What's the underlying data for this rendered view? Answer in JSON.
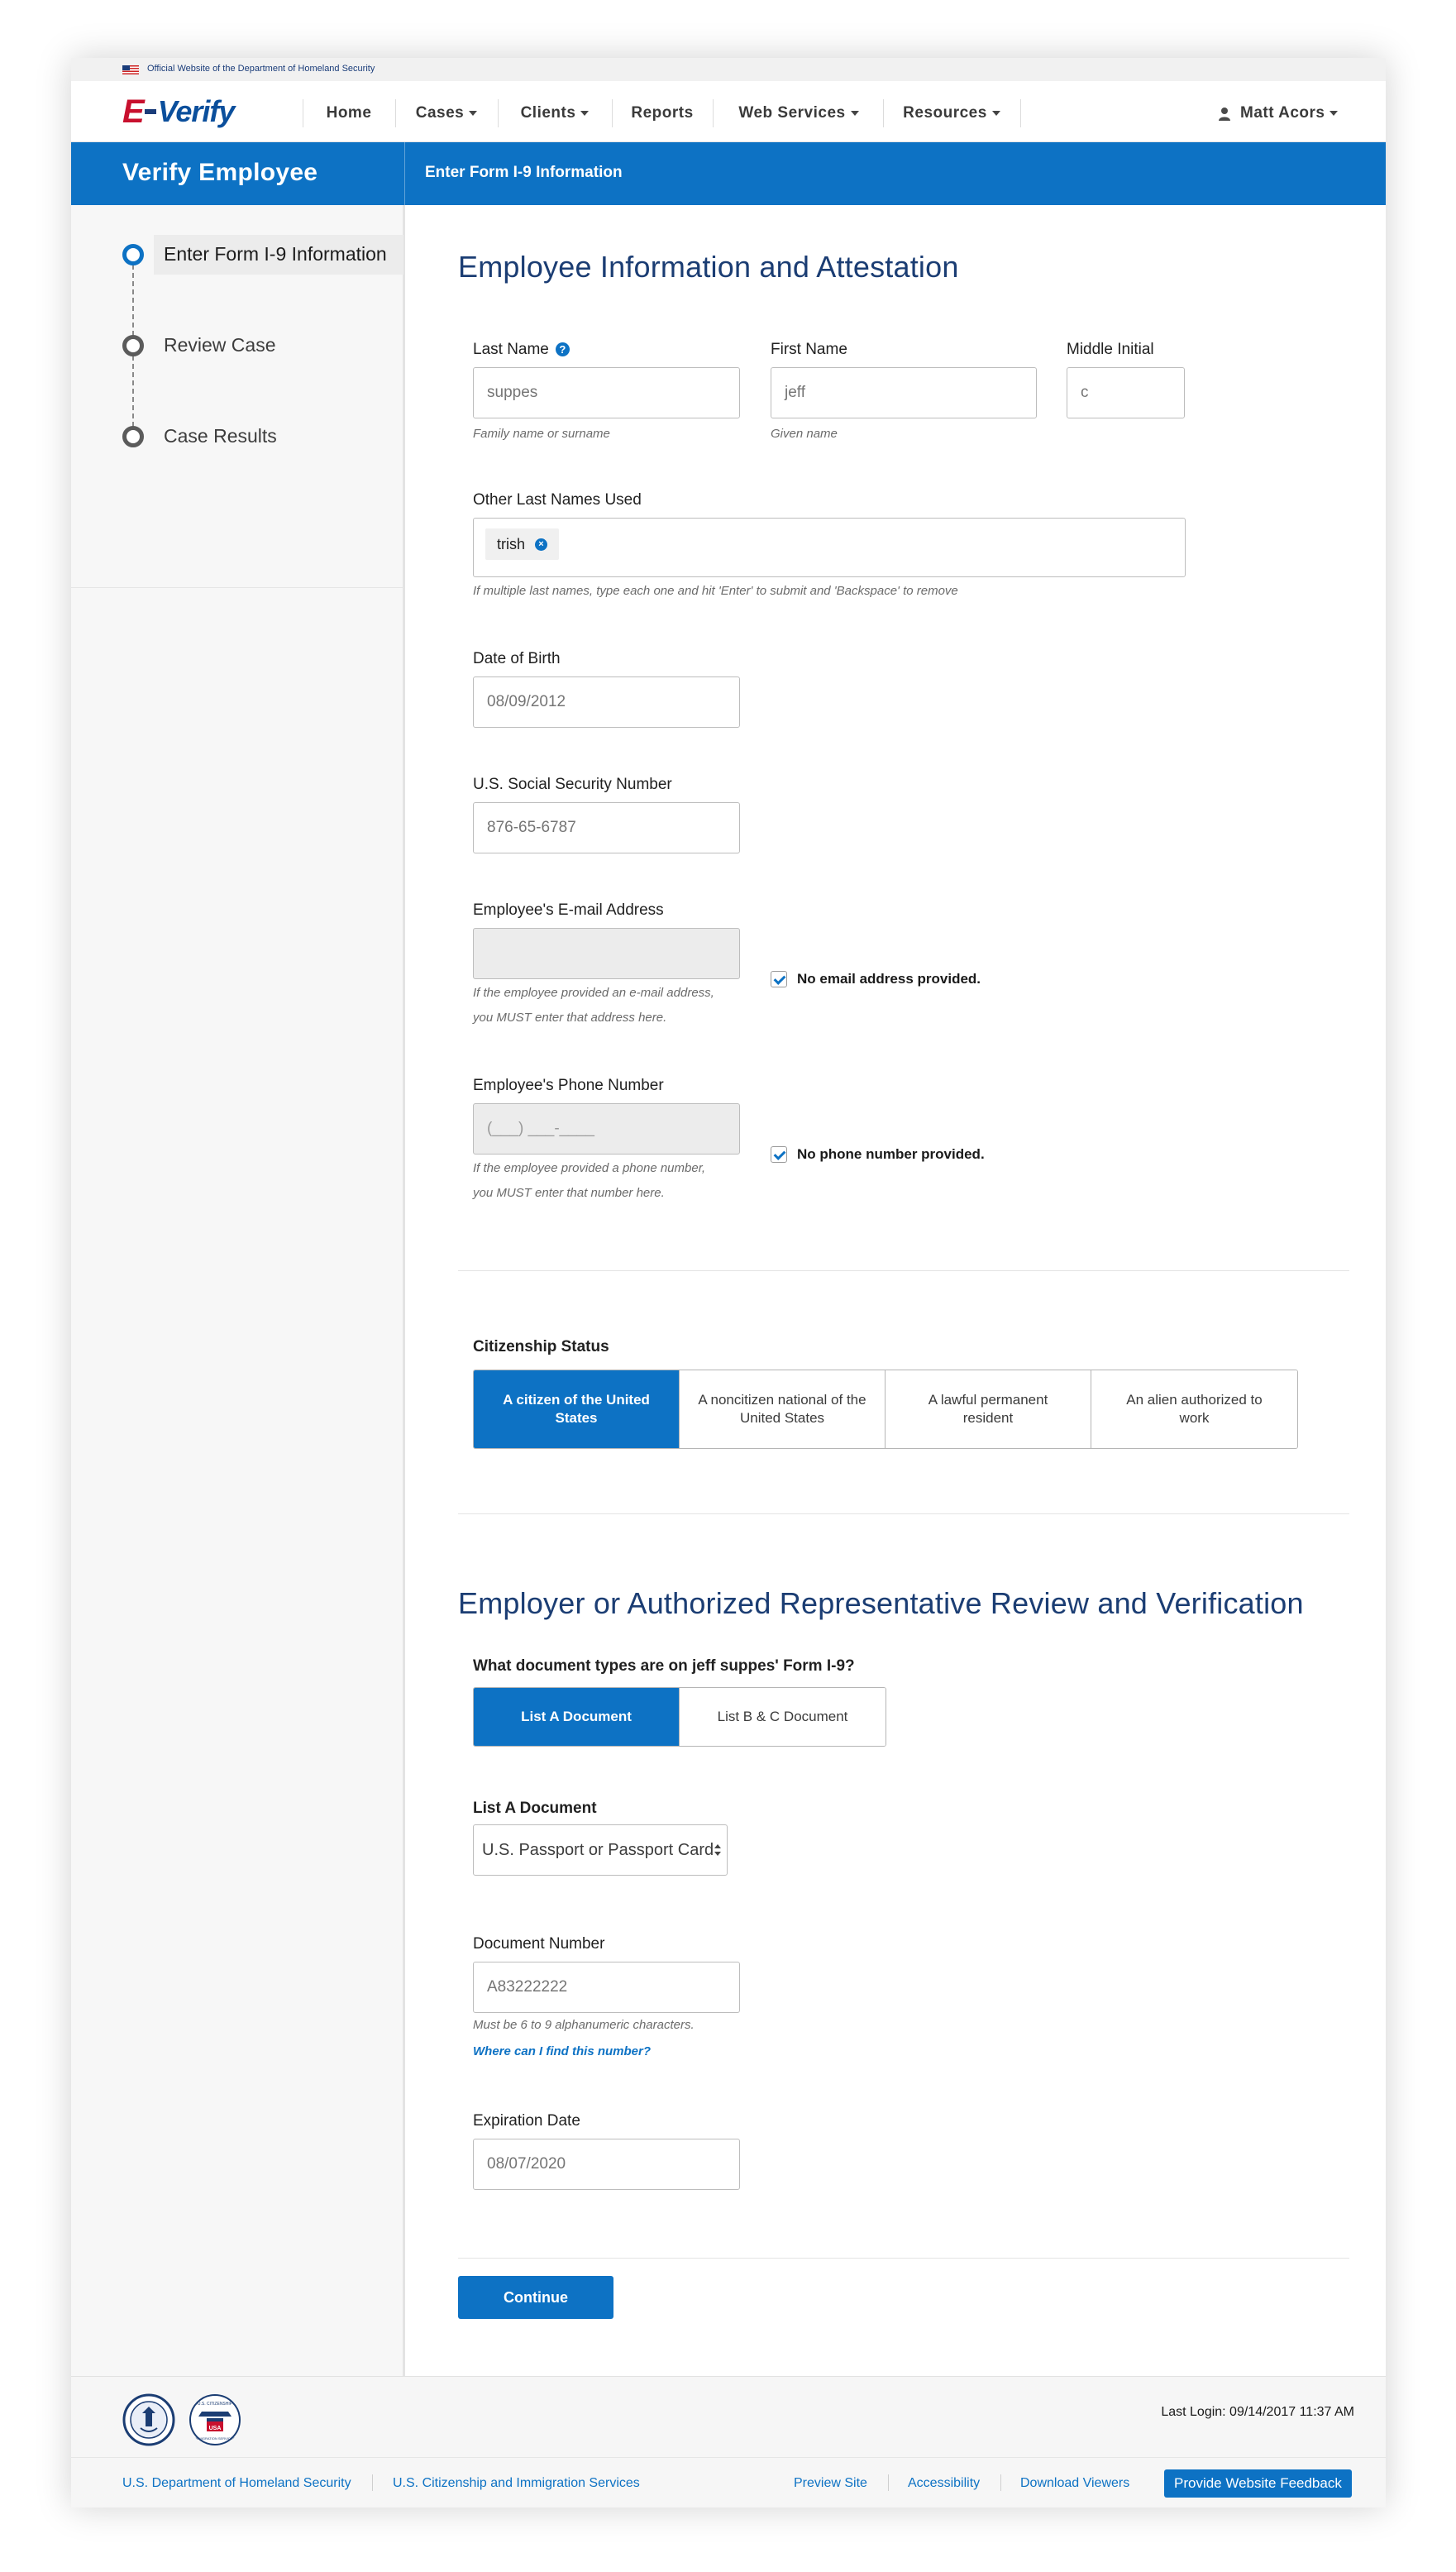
{
  "gov_banner": {
    "text": "Official Website of the Department of Homeland Security"
  },
  "header": {
    "logo_e": "E",
    "logo_verify": "Verify",
    "nav": [
      {
        "label": "Home",
        "has_caret": false
      },
      {
        "label": "Cases",
        "has_caret": true
      },
      {
        "label": "Clients",
        "has_caret": true
      },
      {
        "label": "Reports",
        "has_caret": false
      },
      {
        "label": "Web Services",
        "has_caret": true
      },
      {
        "label": "Resources",
        "has_caret": true
      }
    ],
    "user": {
      "name": "Matt Acors",
      "icon": "user-icon"
    }
  },
  "titlebar": {
    "left": "Verify Employee",
    "right": "Enter Form I-9 Information"
  },
  "steps": [
    {
      "label": "Enter Form I-9 Information",
      "active": true
    },
    {
      "label": "Review Case",
      "active": false
    },
    {
      "label": "Case Results",
      "active": false
    }
  ],
  "section1": {
    "title": "Employee Information and Attestation",
    "last_name": {
      "label": "Last Name",
      "value": "suppes",
      "hint": "Family name or surname"
    },
    "first_name": {
      "label": "First Name",
      "value": "jeff",
      "hint": "Given name"
    },
    "middle_initial": {
      "label": "Middle Initial",
      "value": "c"
    },
    "other_last_names": {
      "label": "Other Last Names Used",
      "chips": [
        "trish"
      ],
      "hint": "If multiple last names, type each one and hit 'Enter' to submit and 'Backspace' to remove"
    },
    "dob": {
      "label": "Date of Birth",
      "value": "08/09/2012"
    },
    "ssn": {
      "label": "U.S. Social Security Number",
      "value": "876-65-6787"
    },
    "email": {
      "label": "Employee's E-mail Address",
      "value": "",
      "hint1": "If the employee provided an e-mail address,",
      "hint2": "you MUST enter that address here.",
      "checkbox_label": "No email address provided.",
      "checked": true
    },
    "phone": {
      "label": "Employee's Phone Number",
      "placeholder": "(___) ___-____",
      "hint1": "If the employee provided a phone number,",
      "hint2": "you MUST enter that number here.",
      "checkbox_label": "No phone number provided.",
      "checked": true
    },
    "citizenship": {
      "label": "Citizenship Status",
      "options": [
        {
          "label": "A citizen of the United States",
          "selected": true
        },
        {
          "label": "A noncitizen national of the United States",
          "selected": false
        },
        {
          "label": "A lawful permanent resident",
          "selected": false
        },
        {
          "label": "An alien authorized to work",
          "selected": false
        }
      ]
    }
  },
  "section2": {
    "title": "Employer or Authorized Representative Review and Verification",
    "doc_question": "What document types are on jeff suppes' Form I-9?",
    "doc_types": [
      {
        "label": "List A Document",
        "selected": true
      },
      {
        "label": "List B & C Document",
        "selected": false
      }
    ],
    "list_a": {
      "label": "List A Document",
      "value": "U.S. Passport or Passport Card"
    },
    "doc_number": {
      "label": "Document Number",
      "value": "A83222222",
      "hint": "Must be 6 to 9 alphanumeric characters.",
      "link": "Where can I find this number?"
    },
    "expiration": {
      "label": "Expiration Date",
      "value": "08/07/2020"
    },
    "continue_label": "Continue"
  },
  "footer": {
    "last_login": "Last Login: 09/14/2017 11:37 AM",
    "links_left": [
      "U.S. Department of Homeland Security",
      "U.S. Citizenship and Immigration Services"
    ],
    "links_right": [
      "Preview Site",
      "Accessibility",
      "Download Viewers"
    ],
    "feedback_label": "Provide Website Feedback",
    "seal_texts": {
      "uscis_top": "U.S. CITIZENSHIP",
      "uscis_mid": "USA",
      "uscis_bottom": "IMMIGRATION SERVICES"
    }
  },
  "colors": {
    "primary": "#0d72c4",
    "heading": "#1b3d73",
    "logo_red": "#c8102e",
    "logo_blue": "#0b4f9c"
  }
}
